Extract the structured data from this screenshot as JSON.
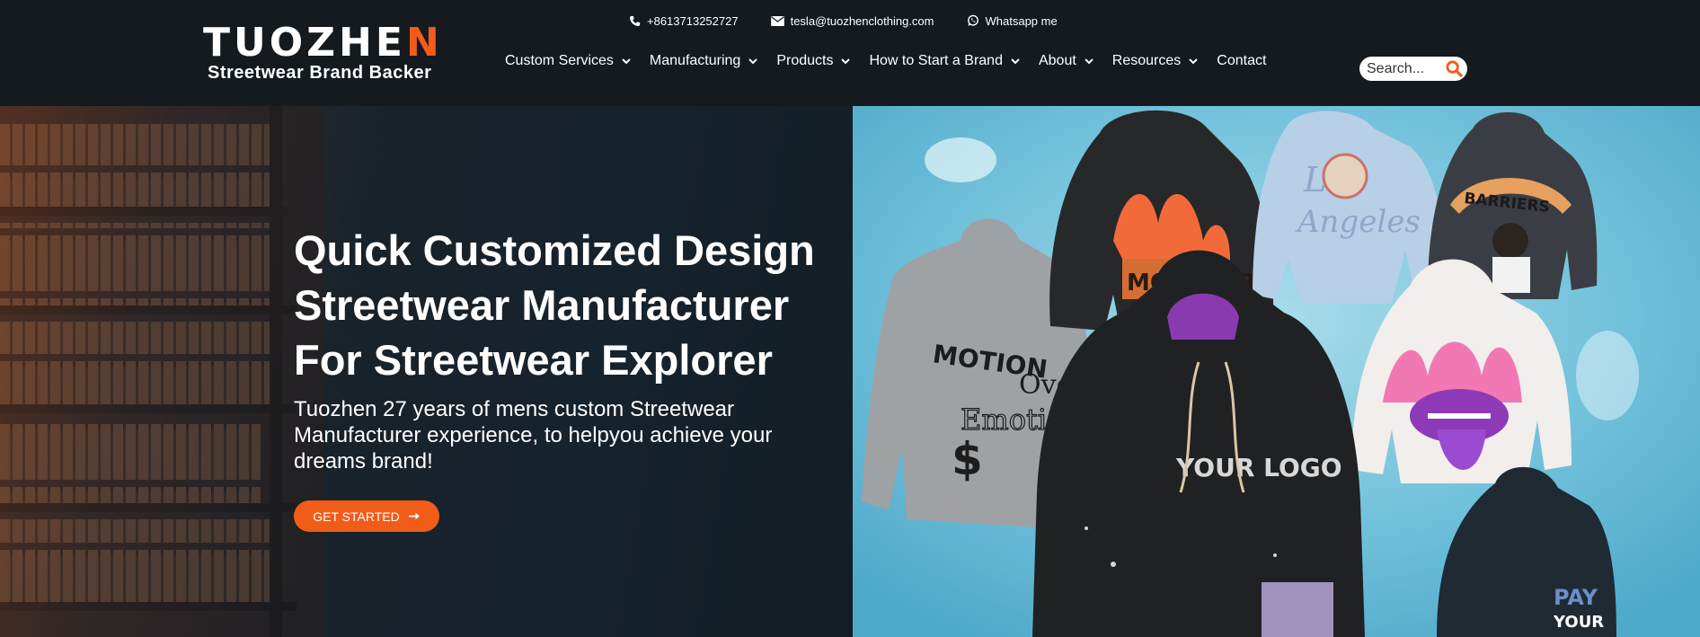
{
  "brand": {
    "logo_main": "TUOZHE",
    "logo_accent": "N",
    "tagline": "Streetwear Brand Backer"
  },
  "topbar": {
    "phone": "+8613713252727",
    "email": "tesla@tuozhenclothing.com",
    "whatsapp": "Whatsapp me"
  },
  "nav": {
    "items": [
      {
        "label": "Custom Services",
        "dropdown": true
      },
      {
        "label": "Manufacturing",
        "dropdown": true
      },
      {
        "label": "Products",
        "dropdown": true
      },
      {
        "label": "How to Start a Brand",
        "dropdown": true
      },
      {
        "label": "About",
        "dropdown": true
      },
      {
        "label": "Resources",
        "dropdown": true
      },
      {
        "label": "Contact",
        "dropdown": false
      }
    ]
  },
  "search": {
    "placeholder": "Search..."
  },
  "hero": {
    "title": "Quick Customized Design\nStreetwear Manufacturer\nFor Streetwear Explorer",
    "subtitle": "Tuozhen 27 years of mens custom Streetwear Manufacturer experience, to helpyou achieve your dreams brand!",
    "cta_label": "GET STARTED"
  },
  "hero_image": {
    "texts": {
      "motion": "MOTION",
      "over": "Over",
      "emotion": "Emotion",
      "monster": "MONSTER",
      "los": "Los",
      "angeles": "Angeles",
      "barriers": "BARRIERS",
      "logo": "YOUR LOGO",
      "pay": "PAY",
      "your": "YOUR"
    }
  },
  "colors": {
    "accent": "#f25c19",
    "header_bg": "#151a1e",
    "hero_dark": "#16222c",
    "sky": "#7ec7de"
  },
  "icons": {
    "phone": "phone-icon",
    "email": "envelope-icon",
    "whatsapp": "whatsapp-icon",
    "search": "search-icon",
    "dropdown": "chevron-down-icon",
    "cta": "arrow-right-icon"
  }
}
